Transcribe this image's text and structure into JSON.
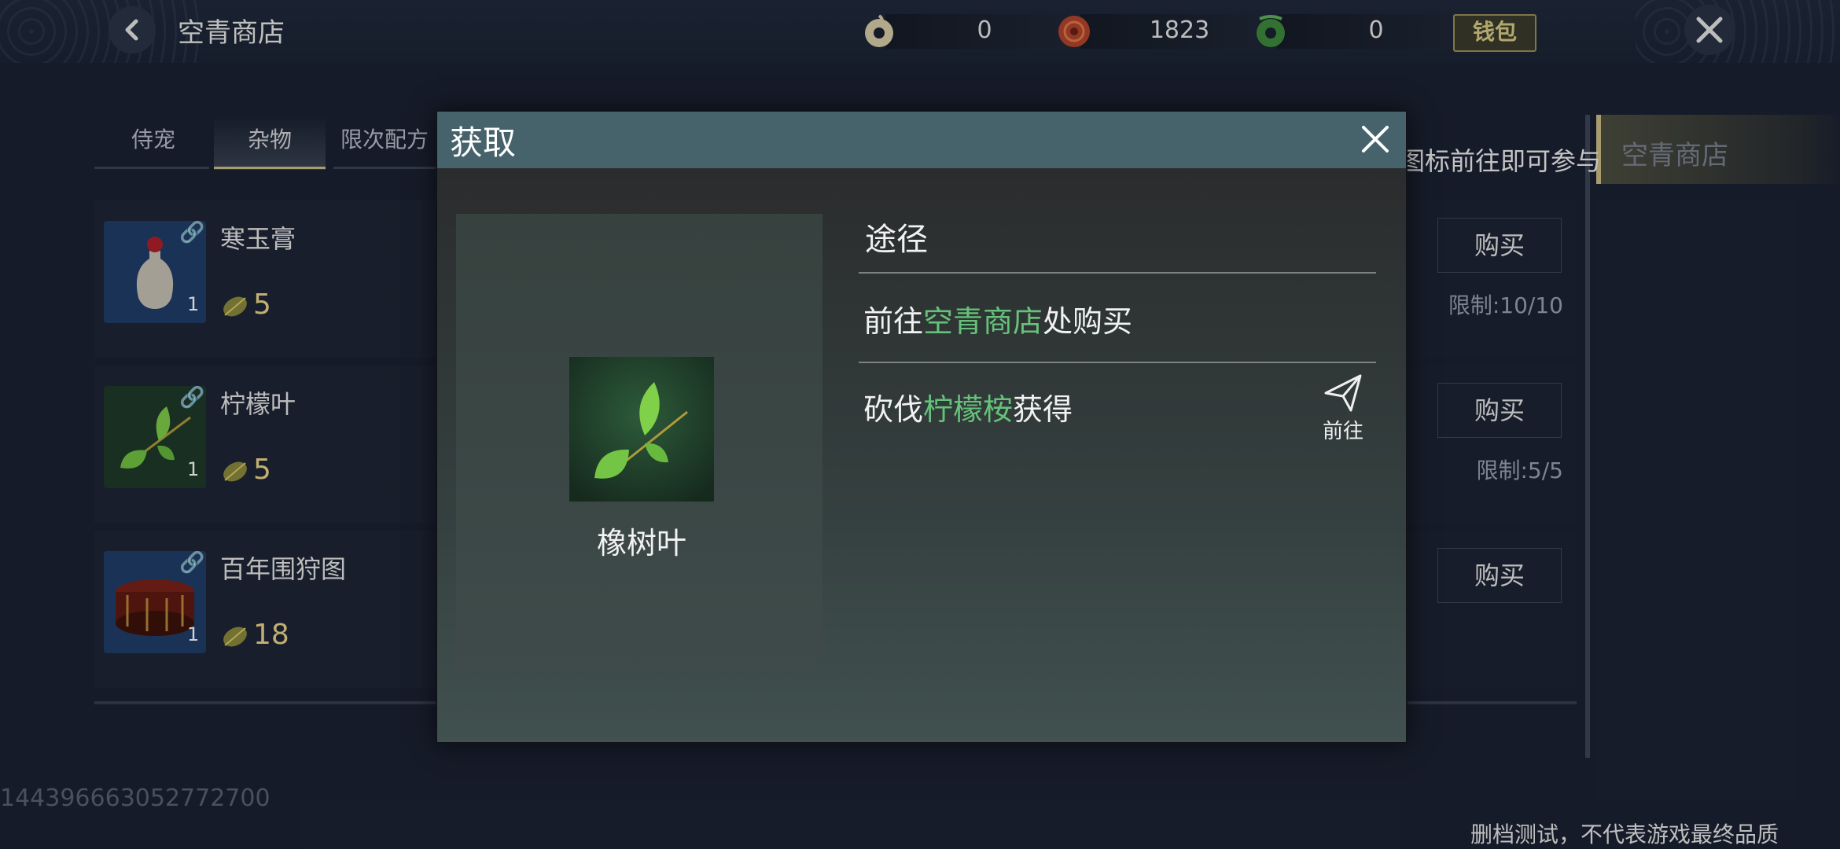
{
  "header": {
    "title": "空青商店",
    "wallet_label": "钱包",
    "resources": [
      {
        "icon": "jade-coin-icon",
        "value": "0",
        "color": "#d8cfa8"
      },
      {
        "icon": "red-token-icon",
        "value": "1823",
        "color": "#b4452c"
      },
      {
        "icon": "green-token-icon",
        "value": "0",
        "color": "#3f8a3e"
      }
    ]
  },
  "tabs": [
    {
      "label": "侍宠",
      "active": false
    },
    {
      "label": "杂物",
      "active": true
    },
    {
      "label": "限次配方",
      "active": false
    }
  ],
  "items": [
    {
      "name": "寒玉膏",
      "qty": "1",
      "price": "5",
      "buy_label": "购买",
      "limit": "限制:10/10",
      "icon": "vase-icon"
    },
    {
      "name": "柠檬叶",
      "qty": "1",
      "price": "5",
      "buy_label": "购买",
      "limit": "限制:5/5",
      "icon": "leaf-icon"
    },
    {
      "name": "百年围狩图",
      "qty": "1",
      "price": "18",
      "buy_label": "购买",
      "limit": "",
      "icon": "drum-icon"
    }
  ],
  "right_panel": {
    "tab_label": "空青商店",
    "marquee": "到图标前往即可参与"
  },
  "footer": {
    "uid": "1443966630527727​00",
    "disclaimer": "删档测试，不代表游戏最终品质"
  },
  "modal": {
    "title": "获取",
    "item_name": "橡树叶",
    "route_header": "途径",
    "routes": [
      {
        "prefix": "前往",
        "highlight": "空青商店",
        "suffix": "处购买",
        "has_go": false
      },
      {
        "prefix": "砍伐",
        "highlight": "柠檬桉",
        "suffix": "获得",
        "has_go": true,
        "go_label": "前往"
      }
    ]
  },
  "colors": {
    "highlight_green": "#66c27a",
    "modal_header": "#46626a",
    "gold_accent": "#cbbf86"
  }
}
